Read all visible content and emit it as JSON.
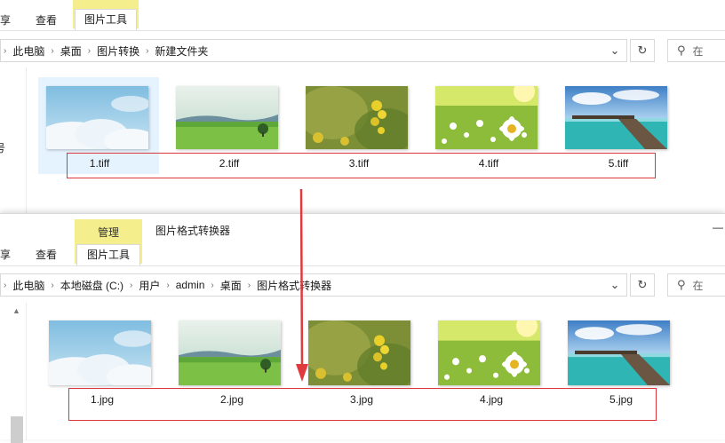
{
  "top": {
    "tabs": {
      "share": "享",
      "view": "查看"
    },
    "context_tab": "图片工具",
    "breadcrumb": [
      "此电脑",
      "桌面",
      "图片转换",
      "新建文件夹"
    ],
    "search_placeholder": "在",
    "left_fragment": "号",
    "files": [
      {
        "name": "1.tiff",
        "icon": "sky-clouds-image"
      },
      {
        "name": "2.tiff",
        "icon": "green-field-image"
      },
      {
        "name": "3.tiff",
        "icon": "yellow-flowers-image"
      },
      {
        "name": "4.tiff",
        "icon": "daisy-meadow-image"
      },
      {
        "name": "5.tiff",
        "icon": "pier-sea-image"
      }
    ]
  },
  "bottom": {
    "tabs": {
      "share": "享",
      "view": "查看"
    },
    "context_group": "管理",
    "context_tab": "图片工具",
    "title": "图片格式转换器",
    "window_control": "—",
    "breadcrumb": [
      "此电脑",
      "本地磁盘 (C:)",
      "用户",
      "admin",
      "桌面",
      "图片格式转换器"
    ],
    "search_placeholder": "在",
    "files": [
      {
        "name": "1.jpg",
        "icon": "sky-clouds-image"
      },
      {
        "name": "2.jpg",
        "icon": "green-field-image"
      },
      {
        "name": "3.jpg",
        "icon": "yellow-flowers-image"
      },
      {
        "name": "4.jpg",
        "icon": "daisy-meadow-image"
      },
      {
        "name": "5.jpg",
        "icon": "pier-sea-image"
      }
    ]
  },
  "colors": {
    "annotation_red": "#d9363e",
    "context_yellow": "#f5ee8c",
    "selection_blue": "#e5f3ff"
  }
}
